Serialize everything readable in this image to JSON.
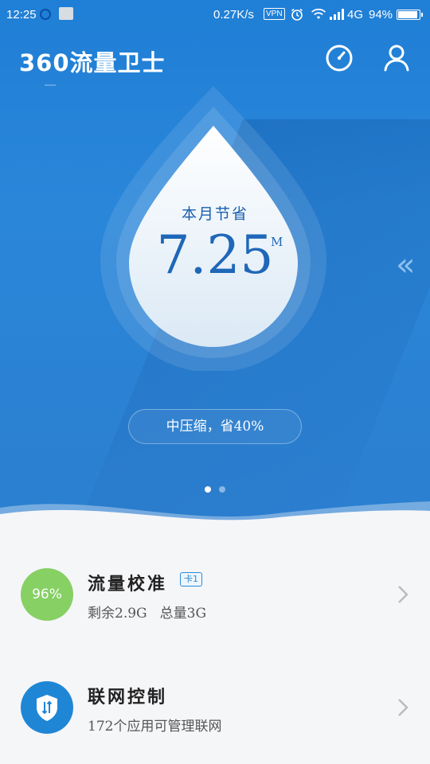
{
  "status_bar": {
    "time": "12:25",
    "speed": "0.27K/s",
    "vpn": "VPN",
    "network": "4G",
    "battery": "94%"
  },
  "header": {
    "title": "360流量卫士"
  },
  "hero": {
    "label": "本月节省",
    "value": "7.25",
    "unit": "M",
    "compression": "中压缩，省40%",
    "page_dots": 2,
    "active_dot": 1
  },
  "cards": [
    {
      "percent": "96%",
      "title": "流量校准",
      "badge": "卡1",
      "remaining": "剩余2.9G",
      "total": "总量3G"
    },
    {
      "title": "联网控制",
      "subtitle": "172个应用可管理联网"
    }
  ],
  "colors": {
    "hero_blue": "#2a86d9",
    "text_blue": "#1f67b8",
    "green": "#86d064"
  }
}
